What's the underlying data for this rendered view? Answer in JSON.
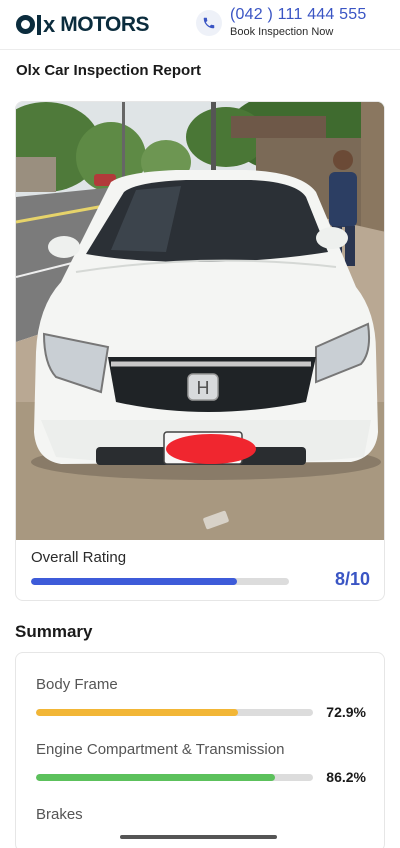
{
  "brand": {
    "logo_text": "MOTORS",
    "logo_alt": "OLX Motors"
  },
  "contact": {
    "phone": "(042 ) 111 444 555",
    "subtitle": "Book Inspection Now"
  },
  "page": {
    "title": "Olx Car Inspection Report"
  },
  "overall": {
    "label": "Overall Rating",
    "value_text": "8/10",
    "fraction": 0.8
  },
  "summary": {
    "title": "Summary",
    "metrics": [
      {
        "label": "Body Frame",
        "value_text": "72.9%",
        "percent": 72.9,
        "color": "#f2b636"
      },
      {
        "label": "Engine Compartment & Transmission",
        "value_text": "86.2%",
        "percent": 86.2,
        "color": "#5cc15c"
      },
      {
        "label": "Brakes"
      }
    ]
  },
  "colors": {
    "accent": "#3a55c4",
    "rating_bar": "#3d5bd9",
    "logo": "#0b2c3d"
  }
}
